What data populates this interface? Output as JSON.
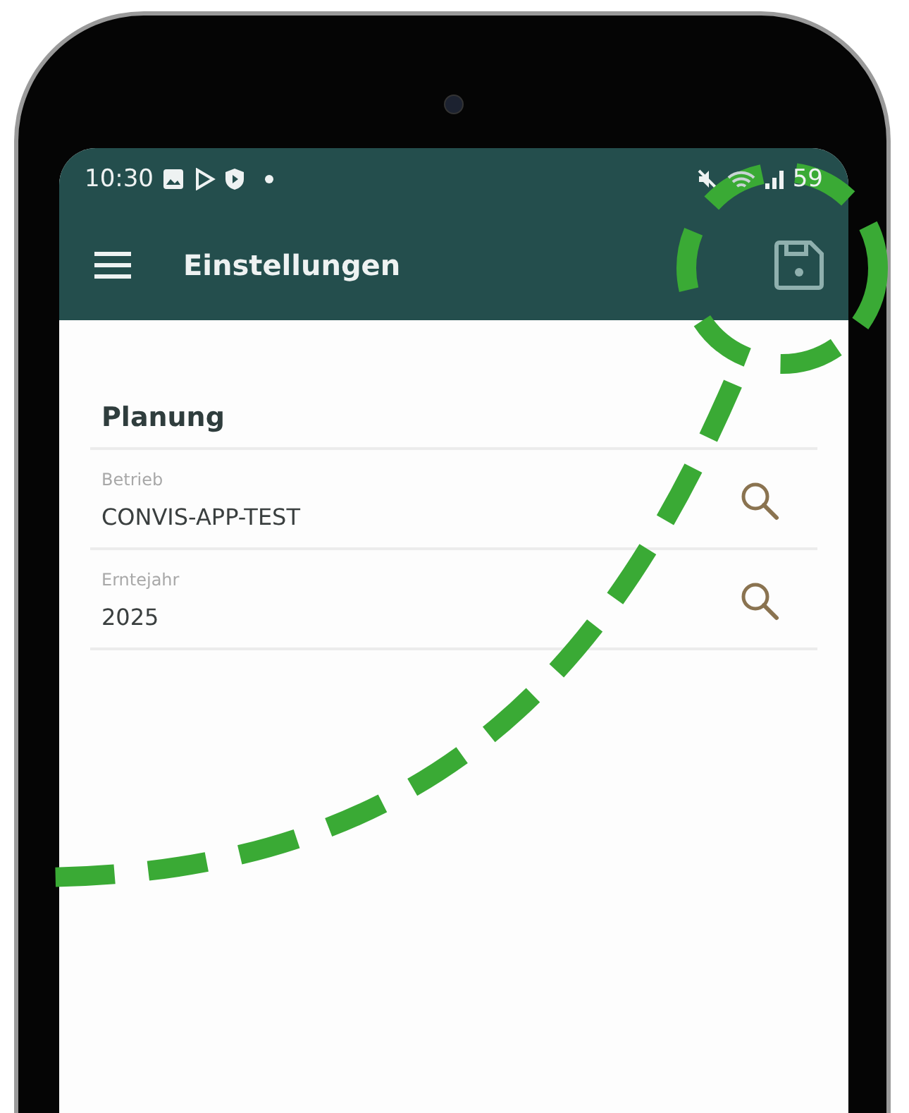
{
  "status_bar": {
    "time": "10:30",
    "battery": "59"
  },
  "app_bar": {
    "title": "Einstellungen"
  },
  "section": {
    "title": "Planung"
  },
  "fields": [
    {
      "label": "Betrieb",
      "value": "CONVIS-APP-TEST"
    },
    {
      "label": "Erntejahr",
      "value": "2025"
    }
  ]
}
